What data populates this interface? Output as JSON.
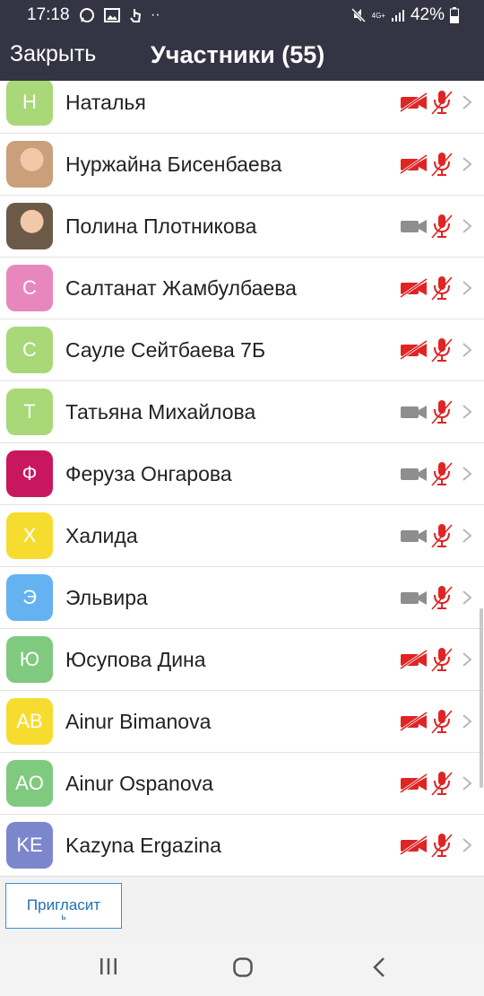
{
  "status_bar": {
    "time": "17:18",
    "battery": "42%",
    "network": "4G+"
  },
  "header": {
    "close_label": "Закрыть",
    "title": "Участники (55)"
  },
  "participants": [
    {
      "initials": "Н",
      "name": "Наталья",
      "avatar_color": "#a8d878",
      "video_muted": true,
      "audio_muted": true,
      "photo": false
    },
    {
      "initials": "",
      "name": "Нуржайна Бисенбаева",
      "avatar_color": "#c9a07a",
      "video_muted": true,
      "audio_muted": true,
      "photo": true
    },
    {
      "initials": "",
      "name": "Полина Плотникова",
      "avatar_color": "#6b5a48",
      "video_muted": false,
      "audio_muted": true,
      "photo": true
    },
    {
      "initials": "С",
      "name": "Салтанат Жамбулбаева",
      "avatar_color": "#e887bd",
      "video_muted": true,
      "audio_muted": true,
      "photo": false
    },
    {
      "initials": "С",
      "name": "Сауле Сейтбаева 7Б",
      "avatar_color": "#a8d878",
      "video_muted": true,
      "audio_muted": true,
      "photo": false
    },
    {
      "initials": "Т",
      "name": "Татьяна Михайлова",
      "avatar_color": "#a8d878",
      "video_muted": false,
      "audio_muted": true,
      "photo": false
    },
    {
      "initials": "Ф",
      "name": "Феруза Онгарова",
      "avatar_color": "#c8175e",
      "video_muted": false,
      "audio_muted": true,
      "photo": false
    },
    {
      "initials": "Х",
      "name": "Халида",
      "avatar_color": "#f7dc30",
      "video_muted": false,
      "audio_muted": true,
      "photo": false
    },
    {
      "initials": "Э",
      "name": "Эльвира",
      "avatar_color": "#64b3f0",
      "video_muted": false,
      "audio_muted": true,
      "photo": false
    },
    {
      "initials": "Ю",
      "name": "Юсупова Дина",
      "avatar_color": "#7fca7f",
      "video_muted": true,
      "audio_muted": true,
      "photo": false
    },
    {
      "initials": "AB",
      "name": "Ainur Bimanova",
      "avatar_color": "#f7dc30",
      "video_muted": true,
      "audio_muted": true,
      "photo": false
    },
    {
      "initials": "AO",
      "name": "Ainur Ospanova",
      "avatar_color": "#7fca7f",
      "video_muted": true,
      "audio_muted": true,
      "photo": false
    },
    {
      "initials": "KE",
      "name": "Kazyna Ergazina",
      "avatar_color": "#7b86cc",
      "video_muted": true,
      "audio_muted": true,
      "photo": false
    }
  ],
  "footer": {
    "invite_label": "Пригласит",
    "invite_label_cut": "ь"
  },
  "colors": {
    "header_bg": "#343445",
    "muted_red": "#e02424",
    "icon_gray": "#8e8e8e"
  }
}
